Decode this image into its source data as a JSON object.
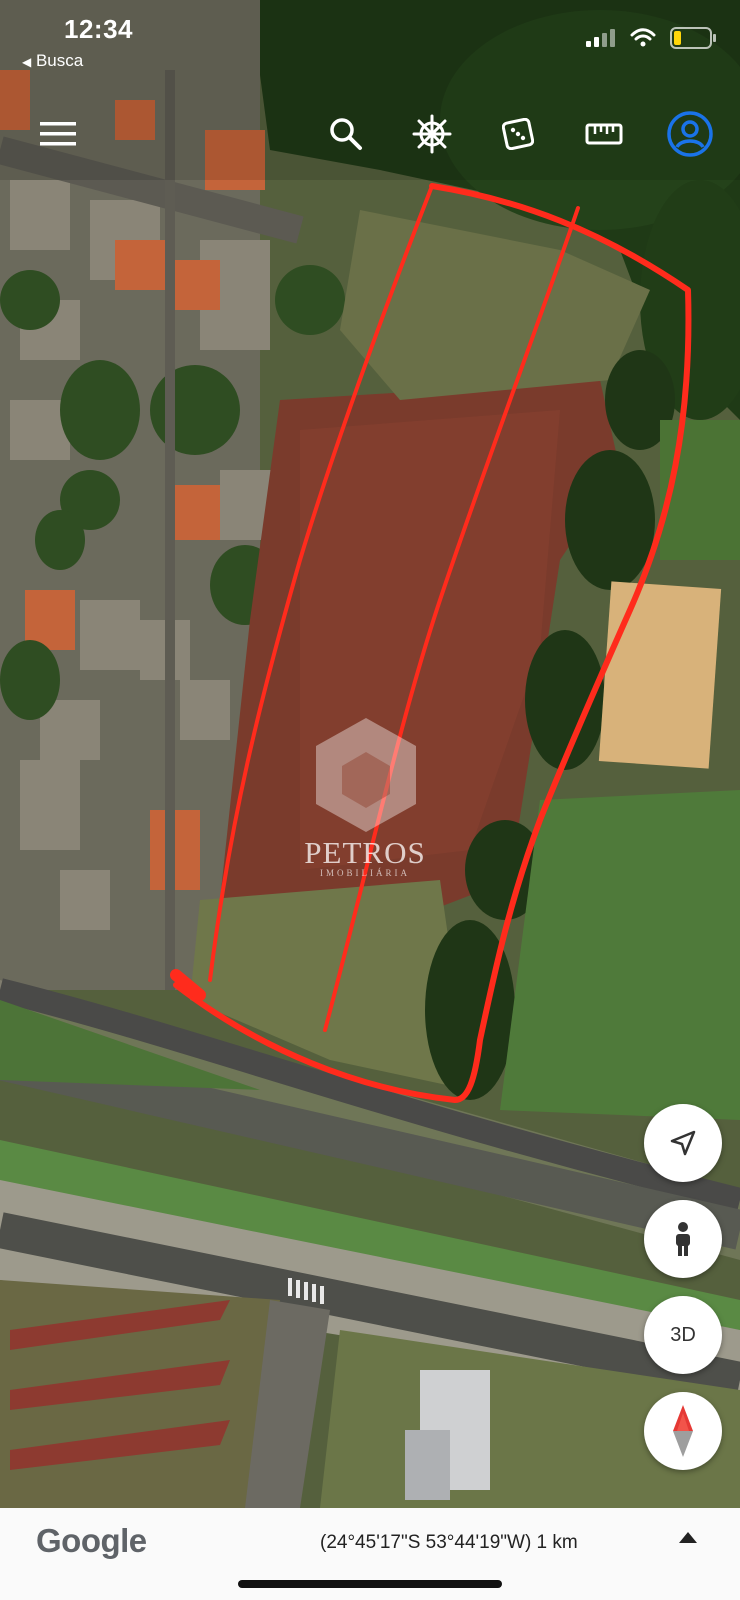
{
  "status_bar": {
    "time": "12:34",
    "back_label": "Busca",
    "battery_color": "#ffd60a"
  },
  "toolbar": {
    "items": [
      {
        "name": "menu-icon"
      },
      {
        "name": "search-icon"
      },
      {
        "name": "voyager-wheel-icon"
      },
      {
        "name": "dice-icon"
      },
      {
        "name": "ruler-icon"
      },
      {
        "name": "profile-icon"
      }
    ],
    "accent_color": "#1a73e8"
  },
  "map": {
    "drawing_color": "#ff2b1c",
    "watermark": {
      "brand": "PETROS",
      "subtitle": "IMOBILIÁRIA"
    }
  },
  "controls": {
    "locate_icon": "navigation-arrow-icon",
    "street_view_icon": "pegman-icon",
    "view_3d_label": "3D",
    "compass_icon": "compass-icon"
  },
  "footer": {
    "logo": "Google",
    "coordinates": "(24°45'17\"S 53°44'19\"W) 1 km",
    "expand_icon": "caret-up-icon"
  }
}
